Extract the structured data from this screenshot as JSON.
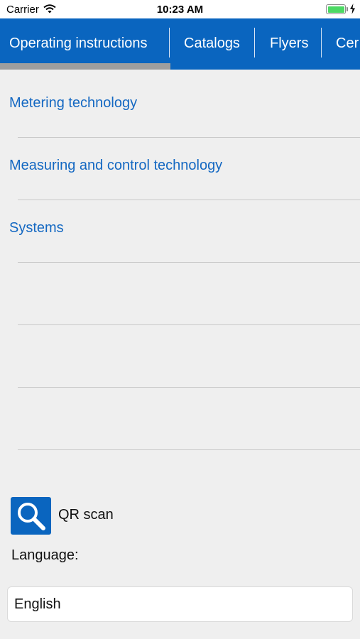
{
  "status_bar": {
    "carrier": "Carrier",
    "time": "10:23 AM"
  },
  "tabs": [
    {
      "label": "Operating instructions",
      "selected": true
    },
    {
      "label": "Catalogs",
      "selected": false
    },
    {
      "label": "Flyers",
      "selected": false
    },
    {
      "label": "Cer",
      "selected": false
    }
  ],
  "categories": [
    {
      "label": "Metering technology"
    },
    {
      "label": "Measuring and control technology"
    },
    {
      "label": "Systems"
    }
  ],
  "qr_scan": {
    "label": "QR scan",
    "icon": "search-icon"
  },
  "language": {
    "label": "Language:",
    "value": "English"
  },
  "colors": {
    "accent": "#0a65bf",
    "link": "#1468c2",
    "background": "#efefef",
    "tab_indicator": "#9e9e9e"
  }
}
